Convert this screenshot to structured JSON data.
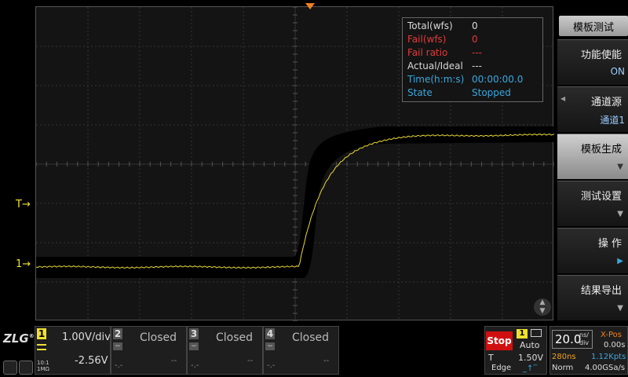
{
  "stats": {
    "rows": [
      {
        "label": "Total(wfs)",
        "value": "0",
        "color": "#d8d8d8"
      },
      {
        "label": "Fail(wfs)",
        "value": "0",
        "color": "#e23a3a"
      },
      {
        "label": "Fail  ratio",
        "value": "---",
        "color": "#e23a3a"
      },
      {
        "label": "Actual/Ideal",
        "value": "---",
        "color": "#d8d8d8"
      },
      {
        "label": "Time(h:m:s)",
        "value": "00:00:00.0",
        "color": "#3aa7e0"
      },
      {
        "label": "State",
        "value": "Stopped",
        "color": "#3aa7e0"
      }
    ]
  },
  "markers": {
    "trigger": "T",
    "channel": "1"
  },
  "menu": {
    "title": "模板测试",
    "items": [
      {
        "label": "功能使能",
        "value": "ON"
      },
      {
        "label": "通道源",
        "value": "通道1"
      },
      {
        "label": "模板生成"
      },
      {
        "label": "测试设置"
      },
      {
        "label": "操 作"
      },
      {
        "label": "结果导出"
      }
    ]
  },
  "channels": {
    "ch1": {
      "num": "1",
      "scale": "1.00V/div",
      "offset": "-2.56V",
      "coupling": "10:1",
      "impedance": "1MΩ",
      "color": "#f0e030"
    },
    "closed": [
      {
        "num": "2",
        "status": "Closed",
        "dash_left": "-.-",
        "dash_right": "--"
      },
      {
        "num": "3",
        "status": "Closed",
        "dash_left": "-.-",
        "dash_right": "--"
      },
      {
        "num": "4",
        "status": "Closed",
        "dash_left": "-.-",
        "dash_right": "--"
      }
    ]
  },
  "trigger": {
    "state": "Stop",
    "source": "1",
    "mode": "Auto",
    "label": "T",
    "level": "1.50V",
    "type": "Edge"
  },
  "timebase": {
    "value": "20.0",
    "unit_top": "ns/",
    "unit_bottom": "div",
    "xpos_label": "X-Pos",
    "xpos": "0.00s",
    "delay": "280ns",
    "points": "1.12Kpts",
    "acq": "Norm",
    "rate": "4.00GSa/s"
  }
}
